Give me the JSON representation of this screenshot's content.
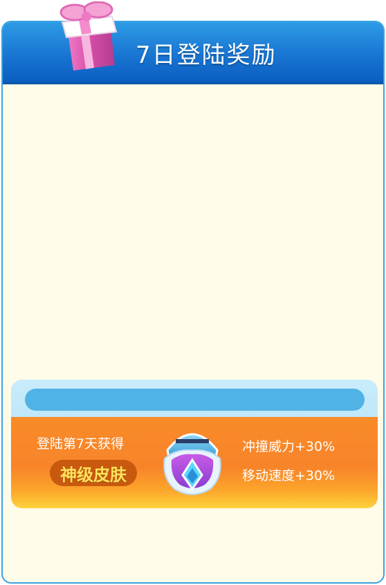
{
  "header": {
    "title": "7日登陆奖励"
  },
  "reward": {
    "login_day_text": "登陆第7天获得",
    "skin_label": "神级皮肤",
    "bonuses": [
      "冲撞威力+30%",
      "移动速度+30%"
    ]
  },
  "icons": {
    "gift": "gift-box-icon",
    "skin": "skin-armor-icon"
  },
  "colors": {
    "header_blue": "#1976d2",
    "panel_bg": "#fefbe9",
    "orange_band": "#f98b28",
    "skin_badge": "#c85a0f",
    "skin_text": "#ffe25c"
  }
}
